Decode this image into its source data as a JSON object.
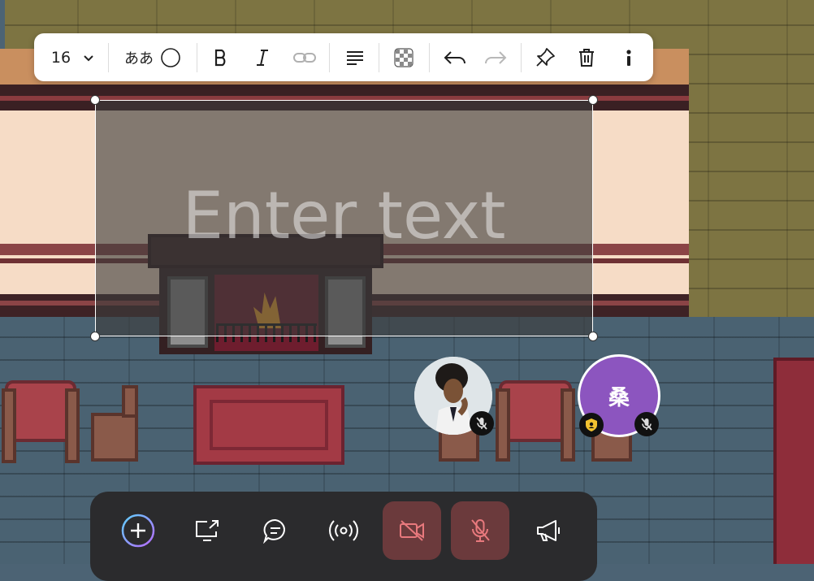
{
  "toolbar": {
    "font_size": "16",
    "kana_sample": "ああ",
    "items": [
      {
        "name": "font-size-dropdown",
        "icon": "chevron-down-icon"
      },
      {
        "name": "font-style",
        "icon": "circle-icon"
      },
      {
        "name": "bold-button",
        "icon": "bold-icon"
      },
      {
        "name": "italic-button",
        "icon": "italic-icon"
      },
      {
        "name": "link-button",
        "icon": "link-icon"
      },
      {
        "name": "align-button",
        "icon": "align-left-icon"
      },
      {
        "name": "background-button",
        "icon": "transparency-icon"
      },
      {
        "name": "undo-button",
        "icon": "undo-icon"
      },
      {
        "name": "redo-button",
        "icon": "redo-icon"
      },
      {
        "name": "pin-button",
        "icon": "pin-icon"
      },
      {
        "name": "delete-button",
        "icon": "trash-icon"
      },
      {
        "name": "more-info-button",
        "icon": "info-icon"
      }
    ]
  },
  "text_box": {
    "placeholder": "Enter text"
  },
  "avatars": [
    {
      "type": "photo",
      "muted": true
    },
    {
      "type": "initial",
      "label": "桑",
      "color": "#8c55bf",
      "muted": true,
      "badge": "shield-icon"
    }
  ],
  "bottom_bar": {
    "buttons": [
      {
        "name": "add-button",
        "icon": "plus-icon"
      },
      {
        "name": "share-screen-button",
        "icon": "screen-share-icon"
      },
      {
        "name": "chat-button",
        "icon": "chat-icon"
      },
      {
        "name": "broadcast-button",
        "icon": "broadcast-icon"
      },
      {
        "name": "camera-off-button",
        "icon": "video-off-icon",
        "state": "off"
      },
      {
        "name": "mic-off-button",
        "icon": "mic-off-icon",
        "state": "off"
      },
      {
        "name": "megaphone-button",
        "icon": "megaphone-icon"
      }
    ]
  },
  "colors": {
    "accent_off": "#e8797d",
    "toolbar_bg": "#ffffff",
    "bar_bg": "#2b2b2d",
    "avatar_purple": "#8c55bf"
  }
}
